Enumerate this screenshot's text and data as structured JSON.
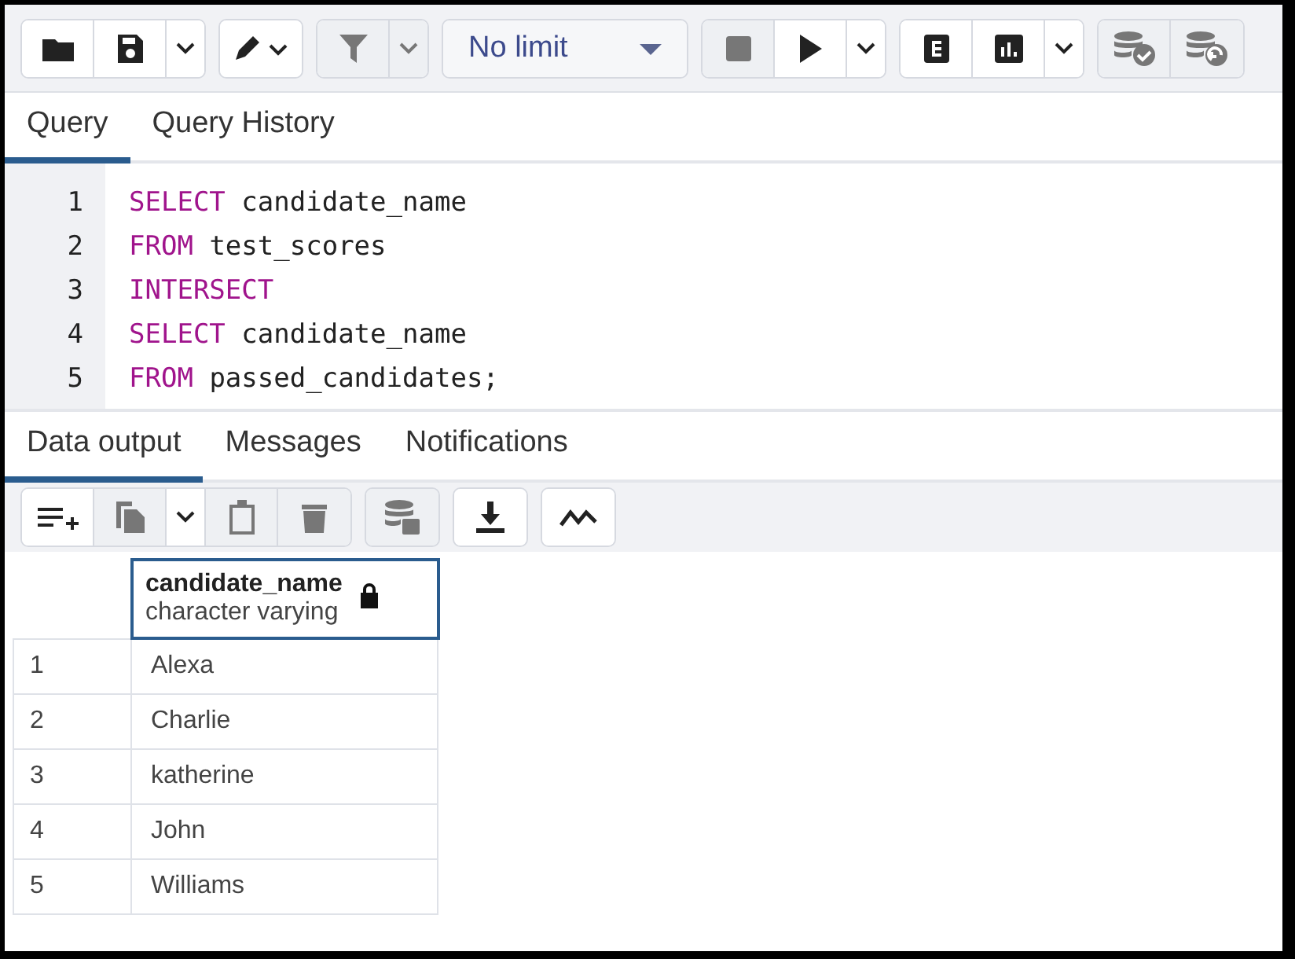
{
  "toolbar": {
    "groups": [
      {
        "buttons": [
          {
            "kind": "folder",
            "disabled": false
          },
          {
            "kind": "save",
            "disabled": false
          },
          {
            "kind": "caret",
            "disabled": false
          }
        ]
      },
      {
        "buttons": [
          {
            "kind": "pencil-caret",
            "disabled": false
          }
        ]
      },
      {
        "buttons": [
          {
            "kind": "filter",
            "disabled": true
          },
          {
            "kind": "caret",
            "disabled": true
          }
        ]
      },
      {
        "buttons": [
          {
            "kind": "limit",
            "label": "No limit"
          }
        ]
      },
      {
        "buttons": [
          {
            "kind": "stop",
            "disabled": true
          },
          {
            "kind": "play",
            "disabled": false
          },
          {
            "kind": "caret",
            "disabled": false
          }
        ]
      },
      {
        "buttons": [
          {
            "kind": "explain",
            "disabled": false
          },
          {
            "kind": "chart",
            "disabled": false
          },
          {
            "kind": "caret",
            "disabled": false
          }
        ]
      },
      {
        "buttons": [
          {
            "kind": "db-check",
            "disabled": true
          },
          {
            "kind": "db-undo",
            "disabled": true
          }
        ]
      }
    ]
  },
  "editor_tabs": [
    {
      "label": "Query",
      "selected": true
    },
    {
      "label": "Query History",
      "selected": false
    }
  ],
  "code_lines": [
    {
      "number": "1",
      "tokens": [
        {
          "kind": "keyword",
          "text": "SELECT"
        },
        {
          "kind": "plain",
          "text": " candidate_name"
        }
      ]
    },
    {
      "number": "2",
      "tokens": [
        {
          "kind": "keyword",
          "text": "FROM"
        },
        {
          "kind": "plain",
          "text": " test_scores"
        }
      ]
    },
    {
      "number": "3",
      "tokens": [
        {
          "kind": "keyword",
          "text": "INTERSECT"
        }
      ]
    },
    {
      "number": "4",
      "tokens": [
        {
          "kind": "keyword",
          "text": "SELECT"
        },
        {
          "kind": "plain",
          "text": " candidate_name"
        }
      ]
    },
    {
      "number": "5",
      "tokens": [
        {
          "kind": "keyword",
          "text": "FROM"
        },
        {
          "kind": "plain",
          "text": " passed_candidates;"
        }
      ]
    }
  ],
  "output_tabs": [
    {
      "label": "Data output",
      "selected": true
    },
    {
      "label": "Messages",
      "selected": false
    },
    {
      "label": "Notifications",
      "selected": false
    }
  ],
  "output_toolbar": {
    "groups": [
      {
        "buttons": [
          {
            "kind": "add-row",
            "disabled": false
          },
          {
            "kind": "copy",
            "disabled": true
          },
          {
            "kind": "caret",
            "disabled": false
          },
          {
            "kind": "paste",
            "disabled": true
          },
          {
            "kind": "delete",
            "disabled": true
          }
        ]
      },
      {
        "buttons": [
          {
            "kind": "db-save",
            "disabled": true
          }
        ]
      },
      {
        "buttons": [
          {
            "kind": "download",
            "disabled": false
          }
        ]
      },
      {
        "buttons": [
          {
            "kind": "graph",
            "disabled": false
          }
        ]
      }
    ]
  },
  "table": {
    "columns": [
      {
        "name": "candidate_name",
        "type": "character varying",
        "locked": true
      }
    ],
    "rows": [
      {
        "number": "1",
        "cells": [
          "Alexa"
        ]
      },
      {
        "number": "2",
        "cells": [
          "Charlie"
        ]
      },
      {
        "number": "3",
        "cells": [
          "katherine"
        ]
      },
      {
        "number": "4",
        "cells": [
          "John"
        ]
      },
      {
        "number": "5",
        "cells": [
          "Williams"
        ]
      }
    ]
  }
}
